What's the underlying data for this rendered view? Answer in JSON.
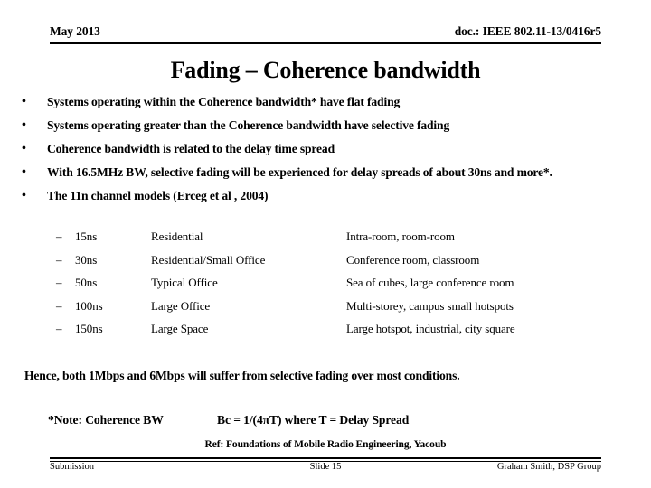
{
  "header": {
    "date": "May 2013",
    "doc": "doc.: IEEE 802.11-13/0416r5"
  },
  "title": "Fading – Coherence bandwidth",
  "bullets": [
    {
      "marker": "•",
      "text": "Systems operating within the Coherence bandwidth* have flat fading"
    },
    {
      "marker": "•",
      "text": "Systems operating greater than the Coherence bandwidth have selective fading"
    },
    {
      "marker": "•",
      "text": "Coherence bandwidth is related to the delay time spread"
    },
    {
      "marker": "•",
      "text": "With 16.5MHz BW, selective fading will be experienced for delay spreads of about 30ns and more*."
    },
    {
      "marker": "•",
      "text": "The 11n channel models (Erceg et al , 2004)"
    }
  ],
  "sublist": {
    "dash": "–",
    "rows": [
      {
        "delay": "15ns",
        "environment": "Residential",
        "description": "Intra-room, room-room"
      },
      {
        "delay": "30ns",
        "environment": "Residential/Small Office",
        "description": "Conference room, classroom"
      },
      {
        "delay": "50ns",
        "environment": "Typical Office",
        "description": "Sea of cubes, large conference room"
      },
      {
        "delay": "100ns",
        "environment": "Large Office",
        "description": "Multi-storey, campus small hotspots"
      },
      {
        "delay": "150ns",
        "environment": "Large Space",
        "description": "Large hotspot, industrial, city square"
      }
    ]
  },
  "conclusion": "Hence, both 1Mbps and 6Mbps will suffer from selective fading over most conditions.",
  "note": {
    "label": "*Note:  Coherence BW",
    "formula": "Bc = 1/(4πT) where  T = Delay Spread"
  },
  "reference": "Ref:  Foundations of Mobile Radio Engineering, Yacoub",
  "footer": {
    "left": "Submission",
    "center": "Slide 15",
    "right": "Graham Smith, DSP Group"
  }
}
